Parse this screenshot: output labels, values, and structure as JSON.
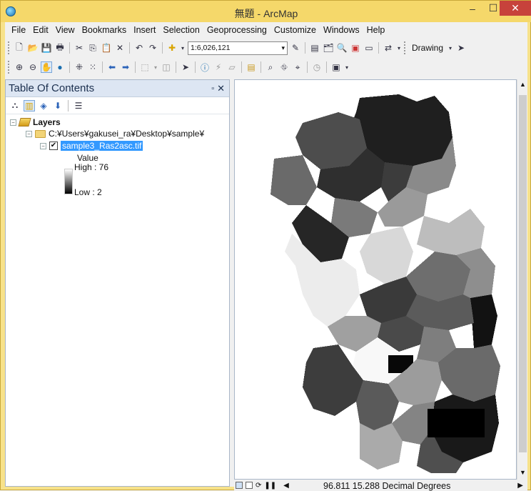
{
  "window": {
    "title": "無題 - ArcMap",
    "min": "–",
    "max": "☐",
    "close": "✕"
  },
  "menu": [
    "File",
    "Edit",
    "View",
    "Bookmarks",
    "Insert",
    "Selection",
    "Geoprocessing",
    "Customize",
    "Windows",
    "Help"
  ],
  "toolbar": {
    "scale": "1:6,026,121",
    "drawing": "Drawing"
  },
  "toc": {
    "title": "Table Of Contents",
    "pin": "▫",
    "close": "✕",
    "root": "Layers",
    "folder": "C:¥Users¥gakusei_ra¥Desktop¥sample¥",
    "layer": "sample3_Ras2asc.tif",
    "legend_title": "Value",
    "high": "High : 76",
    "low": "Low : 2"
  },
  "status": {
    "coords": "96.811  15.288 Decimal Degrees"
  }
}
